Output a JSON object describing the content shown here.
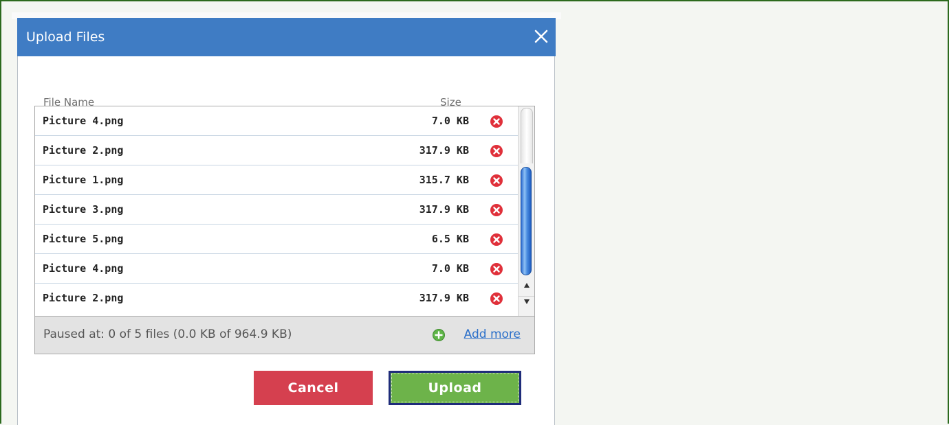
{
  "dialog": {
    "title": "Upload Files",
    "close_icon": "close-icon"
  },
  "columns": {
    "file_name": "File Name",
    "size": "Size"
  },
  "files": [
    {
      "name": "Picture 4.png",
      "size": "7.0 KB"
    },
    {
      "name": "Picture 2.png",
      "size": "317.9 KB"
    },
    {
      "name": "Picture 1.png",
      "size": "315.7 KB"
    },
    {
      "name": "Picture 3.png",
      "size": "317.9 KB"
    },
    {
      "name": "Picture 5.png",
      "size": "6.5 KB"
    },
    {
      "name": "Picture 4.png",
      "size": "7.0 KB"
    },
    {
      "name": "Picture 2.png",
      "size": "317.9 KB"
    }
  ],
  "status": {
    "text": "Paused at: 0 of 5 files (0.0 KB of 964.9 KB)",
    "add_more_label": "Add more"
  },
  "buttons": {
    "cancel_label": "Cancel",
    "upload_label": "Upload"
  },
  "colors": {
    "title_bar": "#3f7cc4",
    "cancel": "#d5404f",
    "upload": "#6db34a",
    "link": "#2a6fc9",
    "remove_icon": "#e0303a",
    "add_icon": "#5fb548"
  }
}
